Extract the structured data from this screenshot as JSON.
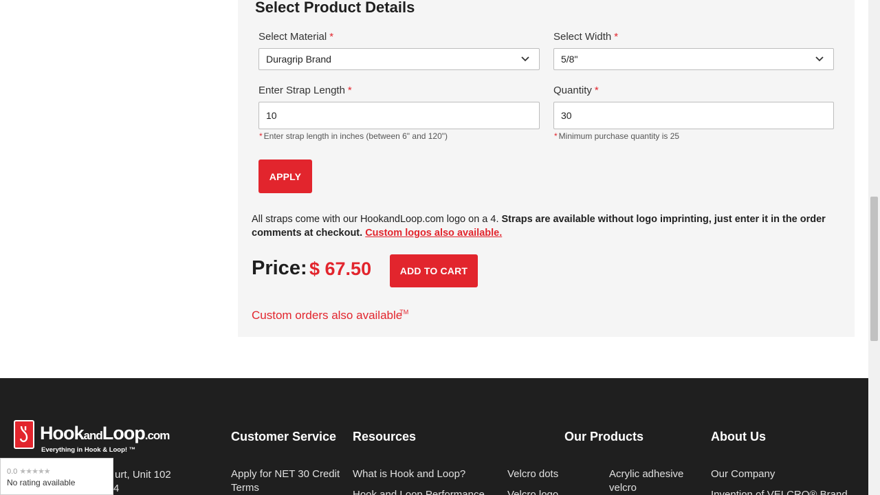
{
  "product_details": {
    "title": "Select Product Details",
    "required_mark": "*",
    "material": {
      "label": "Select Material",
      "value": "Duragrip Brand"
    },
    "width": {
      "label": "Select Width",
      "value": "5/8\""
    },
    "strap_length": {
      "label": "Enter Strap Length",
      "value": "10",
      "hint": "Enter strap length in inches (between 6\" and 120\")"
    },
    "quantity": {
      "label": "Quantity",
      "value": "30",
      "hint": "Minimum purchase quantity is 25"
    },
    "apply_label": "APPLY",
    "note": {
      "intro": "All straps come with our HookandLoop.com logo on a 4.",
      "bold": " Straps are available without logo imprinting, just enter it in the order comments at checkout.",
      "link": "Custom logos also available."
    },
    "price_label": "Price:",
    "price_value": "$ 67.50",
    "add_to_cart_label": "ADD TO CART",
    "custom_orders": "Custom orders also available",
    "custom_orders_tm": "TM"
  },
  "footer": {
    "logo": {
      "hook": "Hook",
      "and": "and",
      "loop": "Loop",
      "dotcom": ".com",
      "tagline": "Everything in Hook & Loop! ™"
    },
    "address_line1": "urt, Unit 102",
    "address_line2": "4",
    "columns": {
      "customer_service": {
        "heading": "Customer Service",
        "link1": "Apply for NET 30 Credit Terms"
      },
      "resources": {
        "heading": "Resources",
        "link1": "What is Hook and Loop?",
        "link2": "Hook and Loop Performance"
      },
      "products_col1": {
        "link1": "Velcro dots",
        "link2": "Velcro logo"
      },
      "our_products": {
        "heading": "Our Products",
        "link1": "Acrylic adhesive velcro"
      },
      "about_us": {
        "heading": "About Us",
        "link1": "Our Company",
        "link2": "Invention of VELCRO® Brand"
      }
    }
  },
  "rating_widget": {
    "score": "0.0",
    "stars": "★★★★★",
    "text": "No rating available"
  },
  "colors": {
    "accent": "#e2252d",
    "footer_bg": "#1f1f1f",
    "panel_bg": "#f5f5f5"
  },
  "icons": {
    "select_chevron": "chevron-down-icon",
    "logo_badge": "hook-logo-icon"
  }
}
